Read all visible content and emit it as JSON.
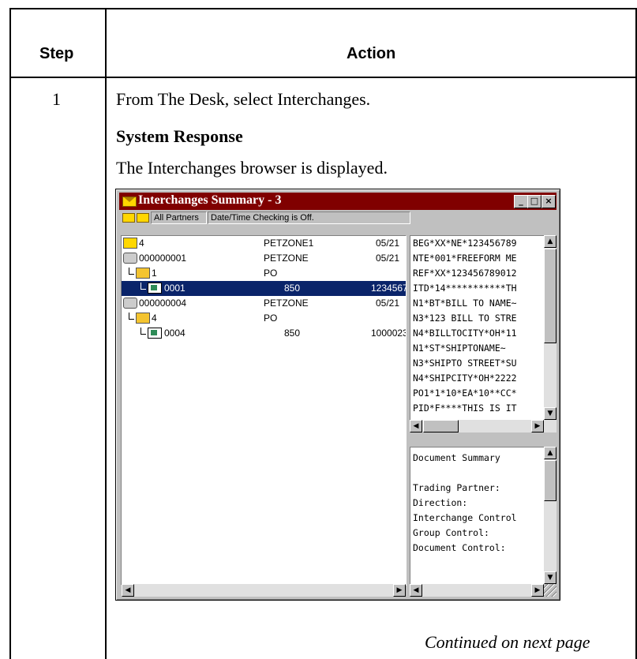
{
  "table": {
    "col_step": "Step",
    "col_action": "Action",
    "step_number": "1",
    "instruction": "From The Desk, select Interchanges.",
    "response_heading": "System Response",
    "response_text": "The Interchanges browser is displayed.",
    "continued": "Continued on next page"
  },
  "window": {
    "title": "Interchanges Summary - 3",
    "toolbar": {
      "partners": "All Partners",
      "datetime_status": "Date/Time Checking is Off."
    },
    "tree": [
      {
        "id": "4",
        "partner": "PETZONE1",
        "date": "05/21"
      },
      {
        "id": "000000001",
        "partner": "PETZONE",
        "date": "05/21"
      },
      {
        "id": "1",
        "partner": "PO",
        "date": ""
      },
      {
        "id": "0001",
        "partner": "850",
        "date": "1234567"
      },
      {
        "id": "000000004",
        "partner": "PETZONE",
        "date": "05/21"
      },
      {
        "id": "4",
        "partner": "PO",
        "date": ""
      },
      {
        "id": "0004",
        "partner": "850",
        "date": "1000023"
      }
    ],
    "edi_lines": [
      "BEG*XX*NE*123456789",
      "NTE*001*FREEFORM ME",
      "REF*XX*123456789012",
      "ITD*14***********TH",
      "N1*BT*BILL TO NAME~",
      "N3*123 BILL TO STRE",
      "N4*BILLTOCITY*OH*11",
      "N1*ST*SHIPTONAME~",
      "N3*SHIPTO STREET*SU",
      "N4*SHIPCITY*OH*2222",
      "PO1*1*10*EA*10**CC*",
      "PID*F****THIS IS IT"
    ],
    "summary_lines": [
      "Document Summary",
      "",
      "Trading Partner:",
      "Direction:",
      "Interchange Control",
      "Group Control:",
      "Document Control:"
    ]
  }
}
